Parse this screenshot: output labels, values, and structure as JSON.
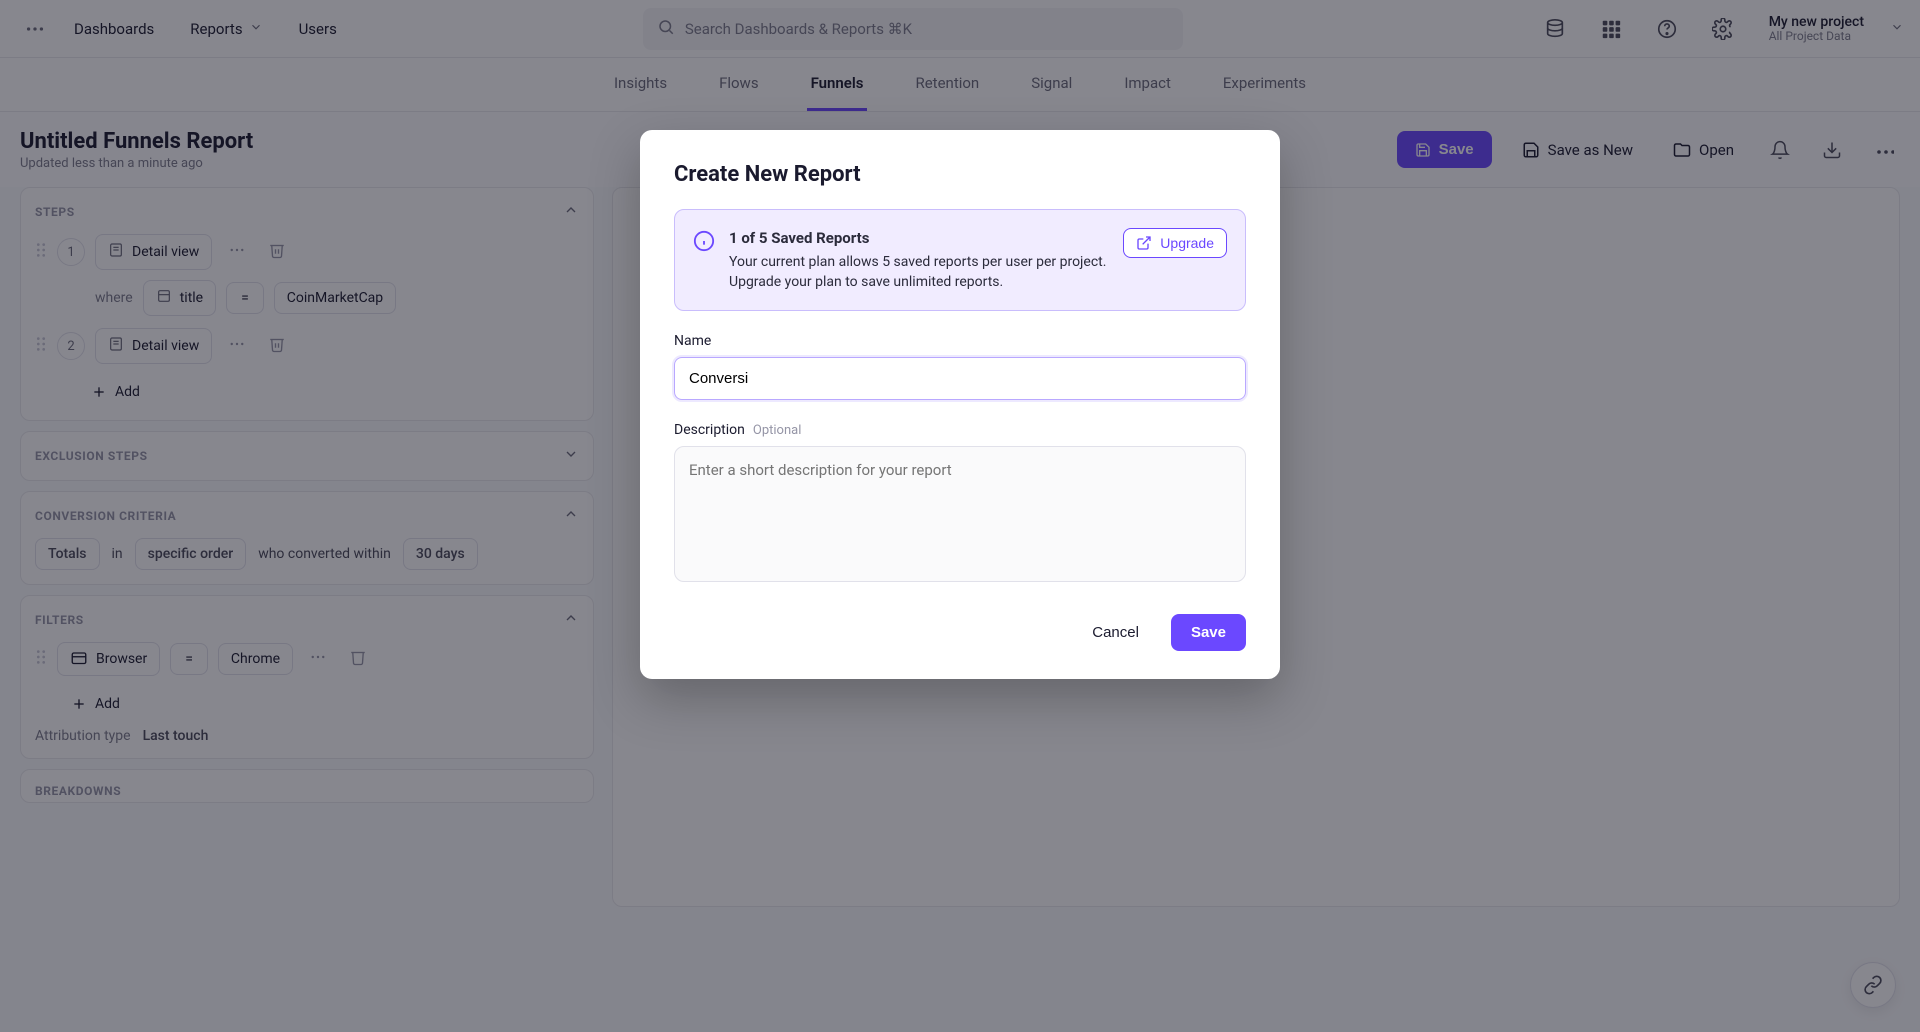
{
  "topnav": {
    "dashboards": "Dashboards",
    "reports": "Reports",
    "users": "Users",
    "search_placeholder": "Search Dashboards & Reports ⌘K",
    "project_title": "My new project",
    "project_sub": "All Project Data"
  },
  "subnav": {
    "insights": "Insights",
    "flows": "Flows",
    "funnels": "Funnels",
    "retention": "Retention",
    "signal": "Signal",
    "impact": "Impact",
    "experiments": "Experiments"
  },
  "report": {
    "title": "Untitled Funnels Report",
    "updated": "Updated less than a minute ago",
    "save": "Save",
    "save_as_new": "Save as New",
    "open": "Open"
  },
  "panels": {
    "steps_title": "STEPS",
    "step1_num": "1",
    "step2_num": "2",
    "detail_view": "Detail view",
    "where": "where",
    "where_field": "title",
    "where_op": "=",
    "where_value": "CoinMarketCap",
    "add": "Add",
    "exclusion_title": "EXCLUSION STEPS",
    "criteria_title": "CONVERSION CRITERIA",
    "criteria": {
      "totals": "Totals",
      "in": "in",
      "order": "specific order",
      "who": "who converted within",
      "window": "30 days"
    },
    "filters_title": "FILTERS",
    "filter_field": "Browser",
    "filter_op": "=",
    "filter_value": "Chrome",
    "attr_label": "Attribution type",
    "attr_value": "Last touch",
    "breakdowns_title": "BREAKDOWNS"
  },
  "modal": {
    "title": "Create New Report",
    "banner_title": "1 of 5 Saved Reports",
    "banner_body": "Your current plan allows 5 saved reports per user per project. Upgrade your plan to save unlimited reports.",
    "upgrade": "Upgrade",
    "name_label": "Name",
    "name_value": "Conversi",
    "desc_label": "Description",
    "desc_optional": "Optional",
    "desc_placeholder": "Enter a short description for your report",
    "cancel": "Cancel",
    "save": "Save"
  }
}
